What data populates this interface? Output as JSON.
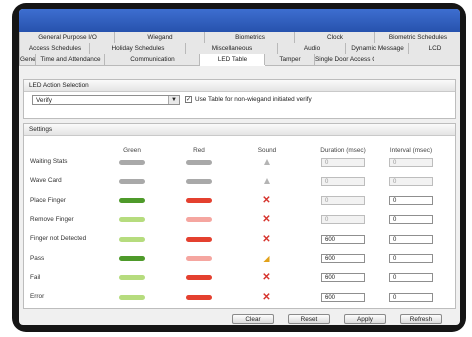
{
  "tabs": {
    "row1": [
      "General Purpose I/O",
      "Wiegand",
      "Biometrics",
      "Clock",
      "Biometric Schedules"
    ],
    "row2": [
      "Access Schedules",
      "Holiday Schedules",
      "Miscellaneous",
      "Audio",
      "Dynamic Message",
      "LCD"
    ],
    "row3": [
      "General",
      "Time and Attendance",
      "Communication",
      "LED Table",
      "Tamper",
      "Single Door Access Control"
    ],
    "active": "LED Table"
  },
  "led_action": {
    "title": "LED Action Selection",
    "selected": "Verify",
    "checkbox_checked": true,
    "checkbox_label": "Use Table for non-wiegand initiated verify"
  },
  "settings": {
    "title": "Settings",
    "columns": {
      "green": "Green",
      "red": "Red",
      "sound": "Sound",
      "duration": "Duration (msec)",
      "interval": "Interval (msec)"
    },
    "rows": [
      {
        "label": "Waiting Stats",
        "green": "gray",
        "red": "gray",
        "sound": "bell-icon",
        "duration": "0",
        "interval": "0",
        "enabled": false
      },
      {
        "label": "Wave Card",
        "green": "gray",
        "red": "gray",
        "sound": "bell-icon",
        "duration": "0",
        "interval": "0",
        "enabled": false
      },
      {
        "label": "Place Finger",
        "green": "dark-green",
        "red": "red",
        "sound": "x-icon",
        "duration": "0",
        "interval": "0",
        "enabled": false
      },
      {
        "label": "Remove Finger",
        "green": "light-green",
        "red": "light-red",
        "sound": "x-icon",
        "duration": "0",
        "interval": "0",
        "enabled": false
      },
      {
        "label": "Finger not Detected",
        "green": "light-green",
        "red": "red",
        "sound": "x-icon",
        "duration": "600",
        "interval": "0",
        "enabled": true
      },
      {
        "label": "Pass",
        "green": "dark-green",
        "red": "light-red",
        "sound": "speaker-icon",
        "duration": "600",
        "interval": "0",
        "enabled": true
      },
      {
        "label": "Fail",
        "green": "light-green",
        "red": "red",
        "sound": "x-icon",
        "duration": "600",
        "interval": "0",
        "enabled": true
      },
      {
        "label": "Error",
        "green": "light-green",
        "red": "red",
        "sound": "x-icon",
        "duration": "600",
        "interval": "0",
        "enabled": true
      }
    ]
  },
  "buttons": {
    "clear": "Clear",
    "reset": "Reset",
    "apply": "Apply",
    "refresh": "Refresh"
  },
  "colors": {
    "gray": "#a9a9a9",
    "dark-green": "#4e9a2a",
    "light-green": "#b6dc7e",
    "red": "#e4402f",
    "light-red": "#f5a6a0",
    "titlebar": "#2f5fc0"
  }
}
